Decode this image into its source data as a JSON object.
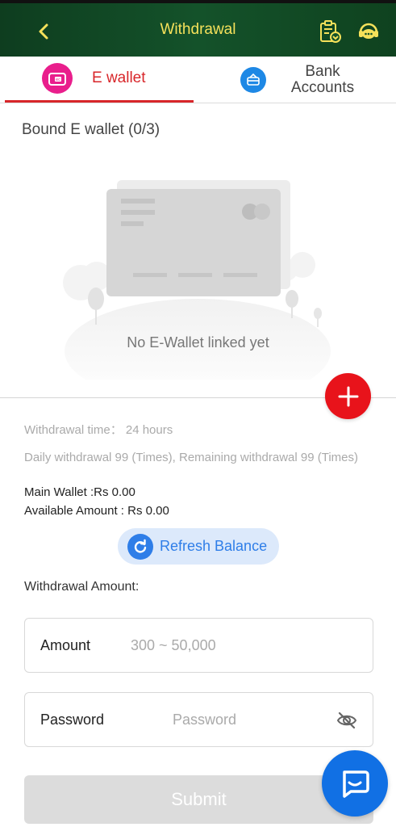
{
  "header": {
    "title": "Withdrawal",
    "back_icon": "chevron-left-icon",
    "records_icon": "clipboard-download-icon",
    "support_icon": "customer-service-icon",
    "bg_color": "#14522a",
    "title_color": "#f5e15a"
  },
  "tabs": [
    {
      "label": "E wallet",
      "icon": "wallet-icon",
      "active": true,
      "color": "#d8262a"
    },
    {
      "label": "Bank Accounts",
      "icon": "bank-card-icon",
      "active": false
    }
  ],
  "bound": {
    "title": "Bound E wallet (0/3)",
    "empty_text": "No E-Wallet linked yet",
    "add_icon": "plus-icon"
  },
  "info": {
    "withdrawal_time": "Withdrawal time：  24 hours",
    "daily_withdrawal": "Daily withdrawal 99 (Times), Remaining withdrawal 99 (Times)",
    "main_wallet": "Main Wallet :Rs 0.00",
    "available_amount": "Available Amount : Rs 0.00"
  },
  "refresh": {
    "label": "Refresh Balance",
    "icon": "refresh-icon",
    "color": "#2f7ee8"
  },
  "form": {
    "section_label": "Withdrawal Amount:",
    "amount_label": "Amount",
    "amount_placeholder": "300 ~ 50,000",
    "password_label": "Password",
    "password_placeholder": "Password",
    "eye_icon": "eye-off-icon",
    "submit_label": "Submit"
  },
  "chat": {
    "icon": "chat-bubble-icon",
    "color": "#1170e4"
  }
}
